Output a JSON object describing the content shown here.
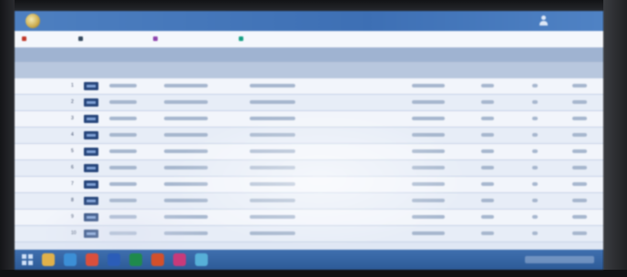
{
  "app": {
    "title": "",
    "user_name": "",
    "header_color": "#3d6fb4",
    "logo_icon": "emblem-icon"
  },
  "toolbar": {
    "items": [
      {
        "label": "",
        "icon": "home-icon",
        "color": "#c0392b"
      },
      {
        "label": "",
        "icon": "list-icon",
        "color": "#34495e"
      },
      {
        "label": "",
        "icon": "document-icon",
        "color": "#8e44ad"
      },
      {
        "label": "",
        "icon": "calendar-icon",
        "color": "#16a085"
      }
    ]
  },
  "table": {
    "group_label": "",
    "columns": [
      "",
      "",
      "",
      "",
      "",
      "",
      "",
      "",
      ""
    ],
    "rows": [
      {
        "num": "1"
      },
      {
        "num": "2"
      },
      {
        "num": "3"
      },
      {
        "num": "4"
      },
      {
        "num": "5"
      },
      {
        "num": "6"
      },
      {
        "num": "7"
      },
      {
        "num": "8"
      },
      {
        "num": "9"
      },
      {
        "num": "10"
      }
    ]
  },
  "taskbar": {
    "apps": [
      {
        "icon": "file-explorer-icon",
        "color": "#e0b14a"
      },
      {
        "icon": "browser-icon",
        "color": "#3c8fd6"
      },
      {
        "icon": "chrome-icon",
        "color": "#d94f3c"
      },
      {
        "icon": "word-icon",
        "color": "#2b5db8"
      },
      {
        "icon": "excel-icon",
        "color": "#1f8a4c"
      },
      {
        "icon": "powerpoint-icon",
        "color": "#d2502b"
      },
      {
        "icon": "media-icon",
        "color": "#c83a7a"
      },
      {
        "icon": "app-icon",
        "color": "#57b0d8"
      }
    ]
  }
}
